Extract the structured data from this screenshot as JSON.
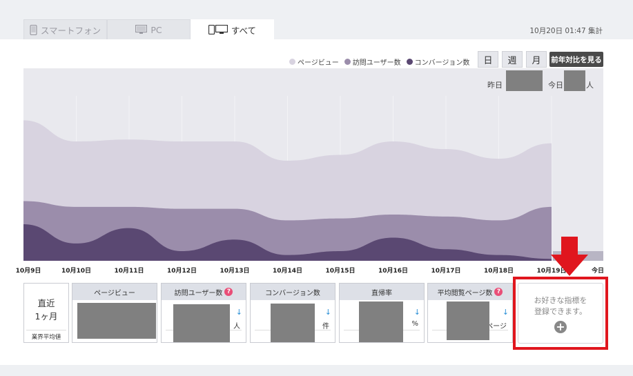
{
  "tabs": [
    {
      "label": "スマートフォン",
      "icon": "smartphone-icon"
    },
    {
      "label": "PC",
      "icon": "monitor-icon"
    },
    {
      "label": "すべて",
      "icon": "all-devices-icon"
    }
  ],
  "aggregated_at": "10月20日 01:47 集計",
  "legend": [
    {
      "label": "ページビュー",
      "color": "#d8d3e0"
    },
    {
      "label": "訪問ユーザー数",
      "color": "#9b8dab"
    },
    {
      "label": "コンバージョン数",
      "color": "#5a4872"
    }
  ],
  "period_buttons": [
    "日",
    "週",
    "月"
  ],
  "yoy_button": "前年対比を見る",
  "chart_overlay": {
    "yesterday_label": "昨日",
    "today_label": "今日",
    "unit": "人"
  },
  "chart_data": {
    "type": "area",
    "stacked": false,
    "categories": [
      "10月9日",
      "10月10日",
      "10月11日",
      "10月12日",
      "10月13日",
      "10月14日",
      "10月15日",
      "10月16日",
      "10月17日",
      "10月18日",
      "10月19日",
      "今日"
    ],
    "series": [
      {
        "name": "ページビュー",
        "values": [
          0.73,
          0.62,
          0.63,
          0.62,
          0.62,
          0.52,
          0.55,
          0.62,
          0.58,
          0.53,
          0.61,
          null
        ]
      },
      {
        "name": "訪問ユーザー数",
        "values": [
          0.31,
          0.28,
          0.28,
          0.27,
          0.27,
          0.21,
          0.22,
          0.24,
          0.23,
          0.21,
          0.28,
          null
        ]
      },
      {
        "name": "コンバージョン数",
        "values": [
          0.19,
          0.09,
          0.17,
          0.05,
          0.11,
          0.03,
          0.05,
          0.12,
          0.06,
          0.03,
          0.01,
          null
        ]
      }
    ],
    "ylim": [
      0,
      1
    ],
    "grid": true
  },
  "recent": {
    "line1": "直近",
    "line2": "1ヶ月",
    "footer": "業界平均値"
  },
  "metric_cards": [
    {
      "title": "ページビュー",
      "unit": "",
      "help": false,
      "arrow": ""
    },
    {
      "title": "訪問ユーザー数",
      "unit": "人",
      "help": true,
      "arrow": "↓"
    },
    {
      "title": "コンバージョン数",
      "unit": "件",
      "help": false,
      "arrow": "↓"
    },
    {
      "title": "直帰率",
      "unit": "%",
      "help": false,
      "arrow": "↓"
    },
    {
      "title": "平均閲覧ページ数",
      "unit": "ページ",
      "help": true,
      "arrow": "↓"
    }
  ],
  "help_mark": "?",
  "add_card": {
    "line1": "お好きな指標を",
    "line2": "登録できます。",
    "plus": "+"
  }
}
